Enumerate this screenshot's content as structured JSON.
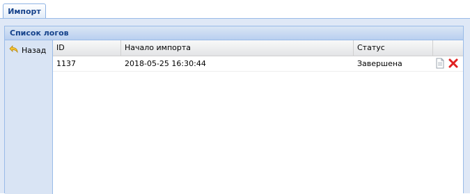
{
  "tabs": [
    {
      "label": "Импорт"
    }
  ],
  "panel": {
    "title": "Список логов"
  },
  "toolbar": {
    "back_label": "Назад"
  },
  "grid": {
    "columns": [
      "ID",
      "Начало импорта",
      "Статус",
      ""
    ],
    "rows": [
      {
        "id": "1137",
        "start": "2018-05-25 16:30:44",
        "status": "Завершена"
      }
    ]
  },
  "icons": {
    "back": "undo-arrow-icon",
    "view": "document-icon",
    "delete": "delete-x-icon"
  },
  "colors": {
    "accent": "#15428b",
    "border": "#99bbe8",
    "delete": "#e02020"
  }
}
